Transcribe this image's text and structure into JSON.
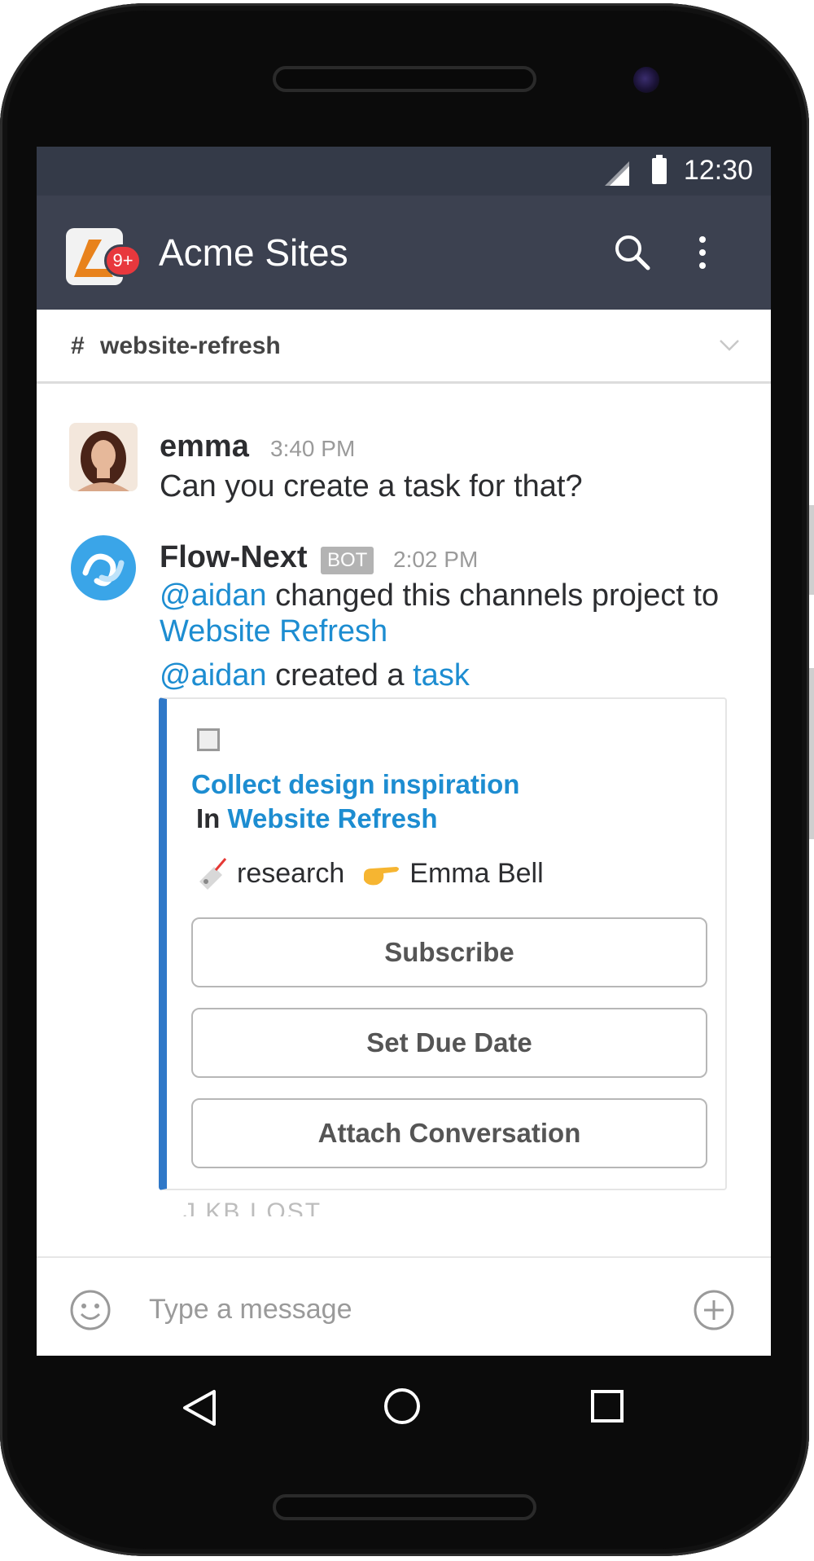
{
  "status_bar": {
    "time": "12:30"
  },
  "app_bar": {
    "title": "Acme Sites",
    "badge": "9+"
  },
  "channel": {
    "hash": "#",
    "name": "website-refresh"
  },
  "messages": [
    {
      "sender": "emma",
      "time": "3:40 PM",
      "text": "Can you create a task for that?"
    },
    {
      "sender": "Flow-Next",
      "tag": "BOT",
      "time": "2:02 PM",
      "line1_mention": "@aidan",
      "line1_text": " changed this channels project to",
      "line1_link": "Website Refresh",
      "line2_mention": "@aidan",
      "line2_text": " created a ",
      "line2_link": "task"
    }
  ],
  "task_card": {
    "title": "Collect design inspiration",
    "project_prefix": "In",
    "project_link": "Website Refresh",
    "tag": "research",
    "assignee": "Emma Bell",
    "buttons": [
      "Subscribe",
      "Set Due Date",
      "Attach Conversation"
    ]
  },
  "faded_text": "J KB I OST",
  "composer": {
    "placeholder": "Type a message"
  },
  "colors": {
    "header": "#3c4150",
    "status_bar": "#343a48",
    "link": "#1d8dd1",
    "card_accent": "#2f78c8",
    "badge": "#e8383d"
  }
}
